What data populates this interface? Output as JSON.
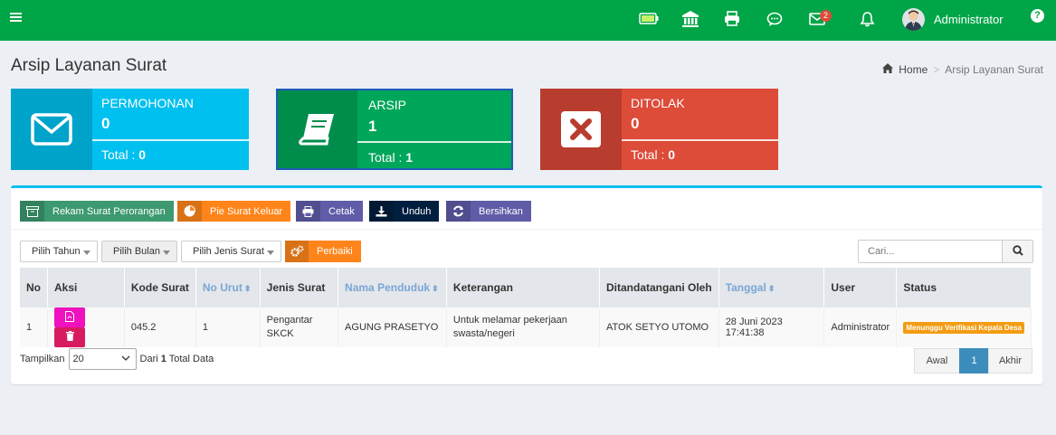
{
  "navbar": {
    "user_name": "Administrator",
    "mail_badge": "2",
    "help": "?"
  },
  "header": {
    "title": "Arsip Layanan Surat",
    "breadcrumb_home": "Home",
    "breadcrumb_sep": ">",
    "breadcrumb_current": "Arsip Layanan Surat"
  },
  "stats": {
    "permohonan": {
      "label": "PERMOHONAN",
      "count": "0",
      "total_label": "Total : ",
      "total": "0"
    },
    "arsip": {
      "label": "ARSIP",
      "count": "1",
      "total_label": "Total : ",
      "total": "1"
    },
    "ditolak": {
      "label": "DITOLAK",
      "count": "0",
      "total_label": "Total : ",
      "total": "0"
    }
  },
  "toolbar": {
    "rekam": "Rekam Surat Perorangan",
    "pie": "Pie Surat Keluar",
    "cetak": "Cetak",
    "unduh": "Unduh",
    "bersihkan": "Bersihkan"
  },
  "filters": {
    "tahun": "Pilih Tahun",
    "bulan": "Pilih Bulan",
    "jenis": "Pilih Jenis Surat",
    "perbaiki": "Perbaiki",
    "search_placeholder": "Cari..."
  },
  "table": {
    "headers": {
      "no": "No",
      "aksi": "Aksi",
      "kode": "Kode Surat",
      "no_urut": "No Urut",
      "jenis": "Jenis Surat",
      "nama": "Nama Penduduk",
      "keterangan": "Keterangan",
      "ditandatangani": "Ditandatangani Oleh",
      "tanggal": "Tanggal",
      "user": "User",
      "status": "Status"
    },
    "rows": [
      {
        "no": "1",
        "kode": "045.2",
        "no_urut": "1",
        "jenis_line1": "Pengantar",
        "jenis_line2": "SKCK",
        "nama": "AGUNG PRASETYO",
        "ket_line1": "Untuk melamar pekerjaan",
        "ket_line2": "swasta/negeri",
        "ditandatangani": "ATOK SETYO UTOMO",
        "tanggal": "28 Juni 2023 17:41:38",
        "user": "Administrator",
        "status": "Menunggu Verifikasi Kepala Desa"
      }
    ]
  },
  "footer": {
    "tampilkan": "Tampilkan",
    "page_size": "20",
    "dari": "Dari",
    "total_count": "1",
    "total_suffix": "Total Data",
    "pager_first": "Awal",
    "pager_current": "1",
    "pager_last": "Akhir"
  },
  "colors": {
    "navbar": "#00a547",
    "permohonan": "#00c0ef",
    "arsip": "#00a65a",
    "ditolak": "#dd4b39"
  }
}
